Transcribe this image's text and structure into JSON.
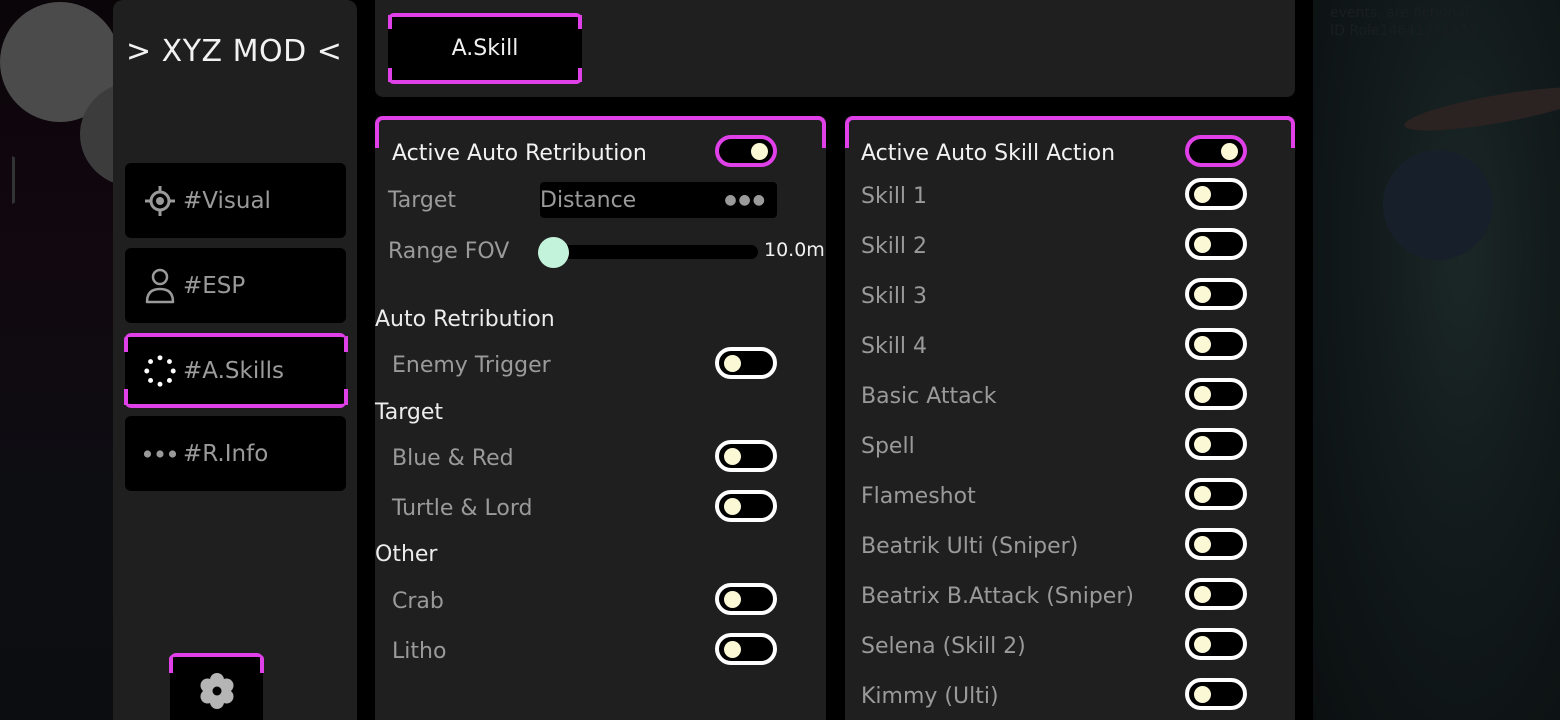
{
  "background": {
    "notice_line1": "events, are fictional.",
    "notice_line2": "ID Role14641771353"
  },
  "sidebar": {
    "title": "> XYZ MOD <",
    "items": [
      {
        "label": "#Visual",
        "icon": "crosshair-icon",
        "active": false
      },
      {
        "label": "#ESP",
        "icon": "user-icon",
        "active": false
      },
      {
        "label": "#A.Skills",
        "icon": "loading-dots-icon",
        "active": true
      },
      {
        "label": "#R.Info",
        "icon": "more-dots-icon",
        "active": false
      }
    ],
    "settings_icon": "gear-icon"
  },
  "tabs": [
    {
      "label": "A.Skill",
      "active": true
    }
  ],
  "colors": {
    "accent": "#e040e8",
    "panel": "#1f1f1f",
    "knob": "#fbf8d6",
    "slider_thumb": "#c4f3dc"
  },
  "retribution": {
    "master": {
      "label": "Active Auto Retribution",
      "on": true
    },
    "target": {
      "label": "Target",
      "value": "Distance"
    },
    "range": {
      "label": "Range FOV",
      "value": 10.0,
      "display": "10.0m",
      "fraction": 0.0
    },
    "sections": [
      {
        "title": "Auto Retribution",
        "items": [
          {
            "label": "Enemy Trigger",
            "on": false
          }
        ]
      },
      {
        "title": "Target",
        "items": [
          {
            "label": "Blue & Red",
            "on": false
          },
          {
            "label": "Turtle & Lord",
            "on": false
          }
        ]
      },
      {
        "title": "Other",
        "items": [
          {
            "label": "Crab",
            "on": false
          },
          {
            "label": "Litho",
            "on": false
          }
        ]
      }
    ]
  },
  "skill_action": {
    "master": {
      "label": "Active Auto Skill Action",
      "on": true
    },
    "items": [
      {
        "label": "Skill 1",
        "on": false
      },
      {
        "label": "Skill 2",
        "on": false
      },
      {
        "label": "Skill 3",
        "on": false
      },
      {
        "label": "Skill 4",
        "on": false
      },
      {
        "label": "Basic Attack",
        "on": false
      },
      {
        "label": "Spell",
        "on": false
      },
      {
        "label": "Flameshot",
        "on": false
      },
      {
        "label": "Beatrik Ulti (Sniper)",
        "on": false
      },
      {
        "label": "Beatrix B.Attack (Sniper)",
        "on": false
      },
      {
        "label": "Selena (Skill 2)",
        "on": false
      },
      {
        "label": "Kimmy (Ulti)",
        "on": false
      }
    ]
  }
}
